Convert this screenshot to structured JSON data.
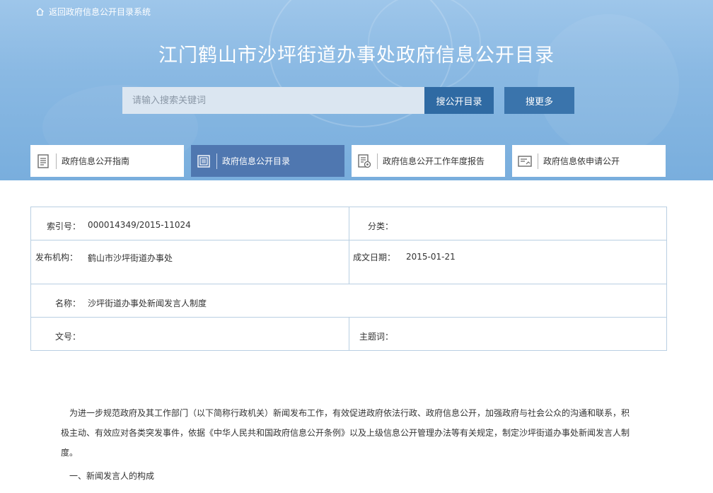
{
  "header": {
    "back_link": "返回政府信息公开目录系统",
    "title": "江门鹤山市沙坪街道办事处政府信息公开目录"
  },
  "search": {
    "placeholder": "请输入搜索关键词",
    "search_button": "搜公开目录",
    "more_button": "搜更多"
  },
  "tabs": [
    {
      "label": "政府信息公开指南",
      "icon": "document-list-icon"
    },
    {
      "label": "政府信息公开目录",
      "icon": "catalog-icon"
    },
    {
      "label": "政府信息公开工作年度报告",
      "icon": "report-icon"
    },
    {
      "label": "政府信息依申请公开",
      "icon": "application-icon"
    }
  ],
  "info": {
    "index_label": "索引号：",
    "index_value": "000014349/2015-11024",
    "category_label": "分类：",
    "category_value": "",
    "publisher_label": "发布机构：",
    "publisher_value": "鹤山市沙坪街道办事处",
    "date_label": "成文日期：",
    "date_value": "2015-01-21",
    "name_label": "名称：",
    "name_value": "沙坪街道办事处新闻发言人制度",
    "docno_label": "文号：",
    "docno_value": "",
    "keyword_label": "主题词：",
    "keyword_value": ""
  },
  "content": {
    "paragraph1": "为进一步规范政府及其工作部门（以下简称行政机关）新闻发布工作，有效促进政府依法行政、政府信息公开，加强政府与社会公众的沟通和联系，积极主动、有效应对各类突发事件，依据《中华人民共和国政府信息公开条例》以及上级信息公开管理办法等有关规定，制定沙坪街道办事处新闻发言人制度。",
    "section1": "一、新闻发言人的构成"
  },
  "colors": {
    "banner": "#8ab9e3",
    "search_button": "#2f6aa3",
    "active_tab": "#4f77b0",
    "table_border": "#b9cfe2"
  }
}
